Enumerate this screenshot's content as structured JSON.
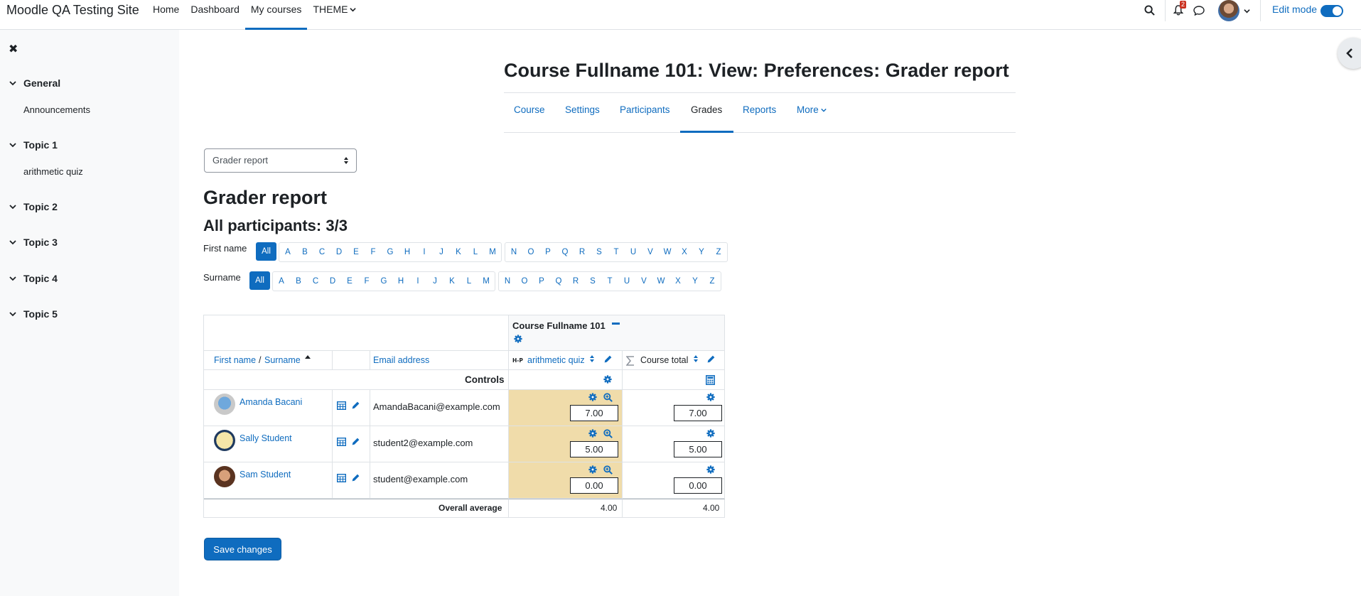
{
  "navbar": {
    "site_name": "Moodle QA Testing Site",
    "items": [
      "Home",
      "Dashboard",
      "My courses",
      "THEME"
    ],
    "active_item": "My courses",
    "notification_count": "2",
    "edit_mode_label": "Edit mode",
    "edit_mode_on": true
  },
  "drawer": {
    "sections": [
      {
        "label": "General",
        "activities": [
          "Announcements"
        ]
      },
      {
        "label": "Topic 1",
        "activities": [
          "arithmetic quiz"
        ]
      },
      {
        "label": "Topic 2",
        "activities": []
      },
      {
        "label": "Topic 3",
        "activities": []
      },
      {
        "label": "Topic 4",
        "activities": []
      },
      {
        "label": "Topic 5",
        "activities": []
      }
    ]
  },
  "header": {
    "title": "Course Fullname 101: View: Preferences: Grader report",
    "tabs": [
      "Course",
      "Settings",
      "Participants",
      "Grades",
      "Reports",
      "More"
    ],
    "active_tab": "Grades"
  },
  "report_selector": {
    "value": "Grader report"
  },
  "report": {
    "heading": "Grader report",
    "participants_heading": "All participants: 3/3"
  },
  "initials": {
    "firstname_label": "First name",
    "surname_label": "Surname",
    "all_label": "All",
    "group1": [
      "A",
      "B",
      "C",
      "D",
      "E",
      "F",
      "G",
      "H",
      "I",
      "J",
      "K",
      "L",
      "M"
    ],
    "group2": [
      "N",
      "O",
      "P",
      "Q",
      "R",
      "S",
      "T",
      "U",
      "V",
      "W",
      "X",
      "Y",
      "Z"
    ]
  },
  "table": {
    "course_header": "Course Fullname 101",
    "col_firstname": "First name",
    "col_separator": "/",
    "col_surname": "Surname",
    "col_email": "Email address",
    "col_item": "arithmetic quiz",
    "col_total": "Course total",
    "controls_label": "Controls",
    "rows": [
      {
        "name": "Amanda Bacani",
        "email": "AmandaBacani@example.com",
        "grade": "7.00",
        "total": "7.00"
      },
      {
        "name": "Sally Student",
        "email": "student2@example.com",
        "grade": "5.00",
        "total": "5.00"
      },
      {
        "name": "Sam Student",
        "email": "student@example.com",
        "grade": "0.00",
        "total": "0.00"
      }
    ],
    "overall_label": "Overall average",
    "overall_item": "4.00",
    "overall_total": "4.00"
  },
  "save_label": "Save changes",
  "colors": {
    "accent": "#0f6cbf",
    "grade_highlight": "#f0dcaa"
  }
}
